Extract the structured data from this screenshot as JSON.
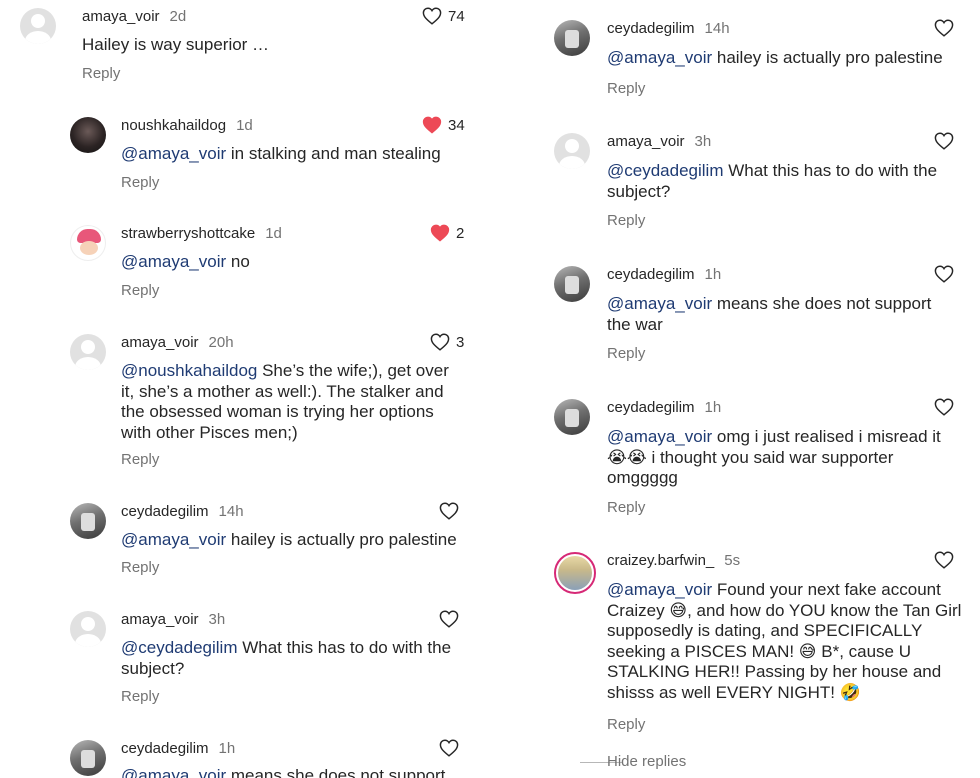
{
  "left": [
    {
      "user": "amaya_voir",
      "time": "2d",
      "avatar": "default",
      "parts": [
        {
          "t": "Hailey is way superior …"
        }
      ],
      "reply": "Reply",
      "likes": "74",
      "liked": false
    },
    {
      "user": "noushkahaildog",
      "time": "1d",
      "avatar": "photo-dark",
      "parts": [
        {
          "m": "@amaya_voir"
        },
        {
          "t": " in stalking and man stealing"
        }
      ],
      "reply": "Reply",
      "likes": "34",
      "liked": true
    },
    {
      "user": "strawberryshottcake",
      "time": "1d",
      "avatar": "photo-straw",
      "parts": [
        {
          "m": "@amaya_voir"
        },
        {
          "t": " no"
        }
      ],
      "reply": "Reply",
      "likes": "2",
      "liked": true
    },
    {
      "user": "amaya_voir",
      "time": "20h",
      "avatar": "default",
      "parts": [
        {
          "m": "@noushkahaildog"
        },
        {
          "t": " She’s the wife;), get over it, she’s a mother as well:). The stalker and the obsessed woman is trying her options with other Pisces men;)"
        }
      ],
      "reply": "Reply",
      "likes": "3",
      "liked": false
    },
    {
      "user": "ceydadegilim",
      "time": "14h",
      "avatar": "photo-cey",
      "parts": [
        {
          "m": "@amaya_voir"
        },
        {
          "t": " hailey is actually pro palestine"
        }
      ],
      "reply": "Reply",
      "likes": "",
      "liked": false
    },
    {
      "user": "amaya_voir",
      "time": "3h",
      "avatar": "default",
      "parts": [
        {
          "m": "@ceydadegilim"
        },
        {
          "t": " What this has to do with the subject?"
        }
      ],
      "reply": "Reply",
      "likes": "",
      "liked": false
    },
    {
      "user": "ceydadegilim",
      "time": "1h",
      "avatar": "photo-cey",
      "parts": [
        {
          "m": "@amaya_voir"
        },
        {
          "t": " means she does not support"
        }
      ],
      "reply": "",
      "likes": "",
      "liked": false
    }
  ],
  "right": [
    {
      "user": "ceydadegilim",
      "time": "14h",
      "avatar": "photo-cey",
      "parts": [
        {
          "m": "@amaya_voir"
        },
        {
          "t": " hailey is actually pro palestine"
        }
      ],
      "reply": "Reply",
      "likes": "",
      "liked": false
    },
    {
      "user": "amaya_voir",
      "time": "3h",
      "avatar": "default",
      "parts": [
        {
          "m": "@ceydadegilim"
        },
        {
          "t": " What this has to do with the subject?"
        }
      ],
      "reply": "Reply",
      "likes": "",
      "liked": false
    },
    {
      "user": "ceydadegilim",
      "time": "1h",
      "avatar": "photo-cey",
      "parts": [
        {
          "m": "@amaya_voir"
        },
        {
          "t": " means she does not support the war"
        }
      ],
      "reply": "Reply",
      "likes": "",
      "liked": false
    },
    {
      "user": "ceydadegilim",
      "time": "1h",
      "avatar": "photo-cey",
      "parts": [
        {
          "m": "@amaya_voir"
        },
        {
          "t": " omg i just realised i misread it 😭😭 i thought you said war supporter omggggg"
        }
      ],
      "reply": "Reply",
      "likes": "",
      "liked": false
    },
    {
      "user": "craizey.barfwin_",
      "time": "5s",
      "avatar": "photo-craizey",
      "parts": [
        {
          "m": "@amaya_voir"
        },
        {
          "t": " Found your next fake account Craizey 😅, and how do YOU know the Tan Girl supposedly is dating, and SPECIFICALLY seeking a PISCES MAN! 😅 B*, cause U STALKING HER!! Passing by her house and shisss as well EVERY NIGHT! 🤣"
        }
      ],
      "reply": "Reply",
      "likes": "",
      "liked": false
    }
  ],
  "hide_replies": "Hide replies",
  "colors": {
    "heart_liked": "#ed4956",
    "mention": "#1f3b73",
    "muted": "#737373"
  }
}
